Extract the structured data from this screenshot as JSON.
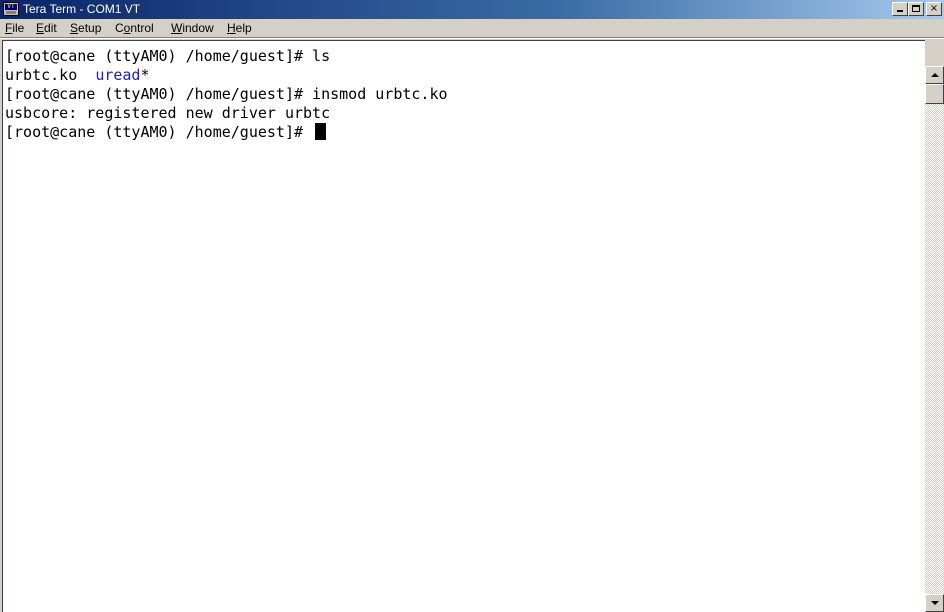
{
  "window": {
    "title": "Tera Term - COM1 VT",
    "icon": "tera-term-icon",
    "icon_label": "VT"
  },
  "title_buttons": {
    "minimize": "minimize",
    "maximize": "maximize",
    "close": "×"
  },
  "menu": {
    "items": [
      {
        "mnemonic": "F",
        "rest": "ile"
      },
      {
        "mnemonic": "E",
        "rest": "dit"
      },
      {
        "mnemonic": "S",
        "rest": "etup"
      },
      {
        "pre": "C",
        "mnemonic": "o",
        "rest": "ntrol"
      },
      {
        "mnemonic": "W",
        "rest": "indow"
      },
      {
        "mnemonic": "H",
        "rest": "elp"
      }
    ]
  },
  "terminal": {
    "lines": [
      {
        "segments": [
          {
            "text": "[root@cane (ttyAM0) /home/guest]# ls",
            "color": "default"
          }
        ]
      },
      {
        "segments": [
          {
            "text": "urbtc.ko  ",
            "color": "default"
          },
          {
            "text": "uread",
            "color": "blue"
          },
          {
            "text": "*",
            "color": "default"
          }
        ]
      },
      {
        "segments": [
          {
            "text": "[root@cane (ttyAM0) /home/guest]# insmod urbtc.ko",
            "color": "default"
          }
        ]
      },
      {
        "segments": [
          {
            "text": "usbcore: registered new driver urbtc",
            "color": "default"
          }
        ]
      },
      {
        "segments": [
          {
            "text": "[root@cane (ttyAM0) /home/guest]# ",
            "color": "default"
          }
        ],
        "cursor": true
      }
    ],
    "colors": {
      "default": "#000000",
      "blue": "#2020c0",
      "background": "#ffffff"
    }
  },
  "colors": {
    "titlebar_start": "#0a246a",
    "titlebar_end": "#a6caf0",
    "chrome": "#d4d0c8"
  }
}
